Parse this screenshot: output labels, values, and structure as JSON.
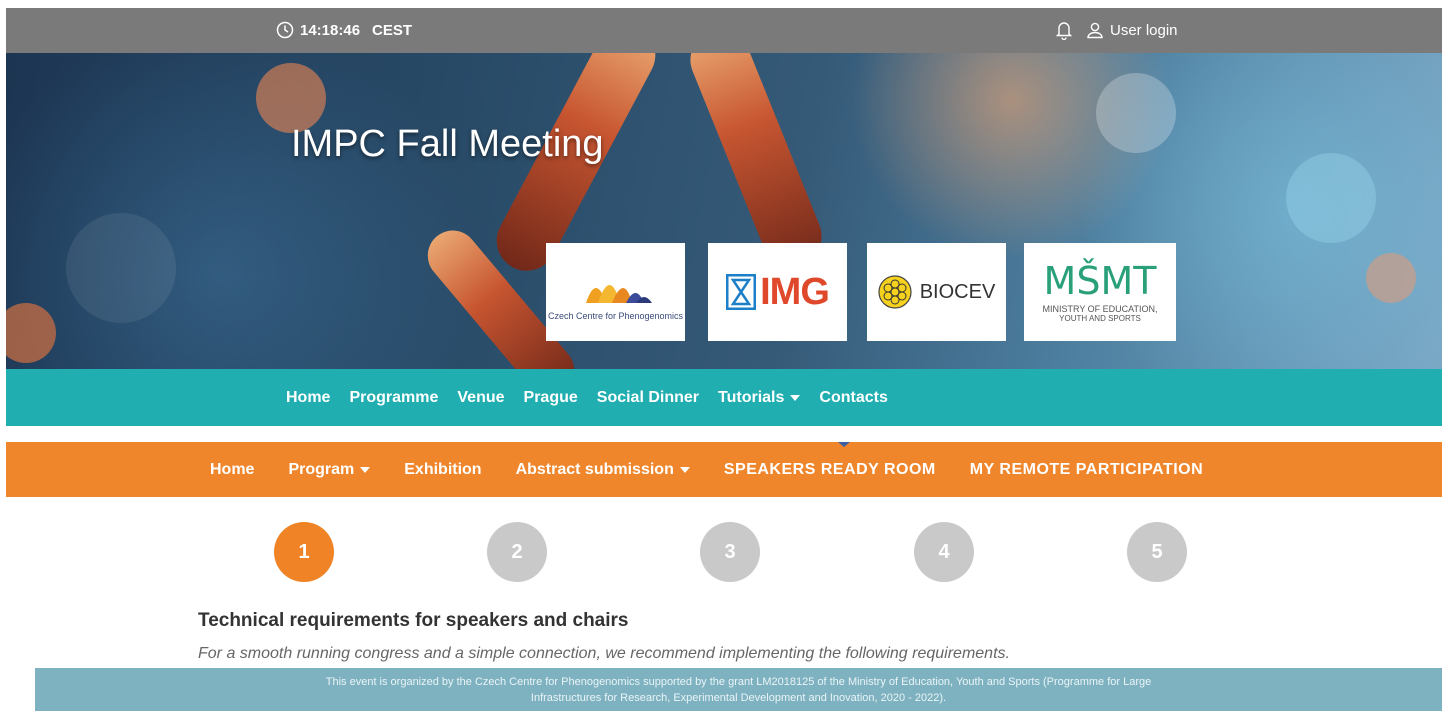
{
  "topbar": {
    "time": "14:18:46",
    "timezone": "CEST",
    "clock_icon": "clock-icon",
    "bell_icon": "bell-icon",
    "user_icon": "user-icon",
    "login_label": "User login"
  },
  "hero": {
    "title": "IMPC Fall Meeting",
    "logos": {
      "ccp_text": "Czech Centre for Phenogenomics",
      "img_text": "IMG",
      "biocev_text": "BIOCEV",
      "msmt_mark": "MŠMT",
      "msmt_line1": "MINISTRY OF EDUCATION,",
      "msmt_line2": "YOUTH AND SPORTS"
    }
  },
  "main_nav": {
    "items": [
      "Home",
      "Programme",
      "Venue",
      "Prague",
      "Social Dinner",
      "Tutorials",
      "Contacts"
    ]
  },
  "sub_nav": {
    "items": [
      "Home",
      "Program",
      "Exhibition",
      "Abstract submission",
      "SPEAKERS READY ROOM",
      "MY REMOTE PARTICIPATION"
    ]
  },
  "steps": {
    "labels": [
      "1",
      "2",
      "3",
      "4",
      "5"
    ],
    "active": 1,
    "colors": {
      "active": "#ef8326",
      "inactive": "#c9c9c9"
    }
  },
  "content": {
    "heading": "Technical requirements for speakers and chairs",
    "subtext": "For a smooth running congress and a simple connection, we recommend implementing the following requirements."
  },
  "footer": {
    "line1": "This event is organized by the Czech Centre for Phenogenomics supported by the grant LM2018125 of the Ministry of Education, Youth and Sports (Programme for Large",
    "line2": "Infrastructures for Research, Experimental Development and Inovation, 2020 - 2022)."
  },
  "colors": {
    "topbar": "#7a7a7a",
    "teal_nav": "#20aeb0",
    "orange_nav": "#f0862b",
    "footer": "#7fb2c0"
  }
}
